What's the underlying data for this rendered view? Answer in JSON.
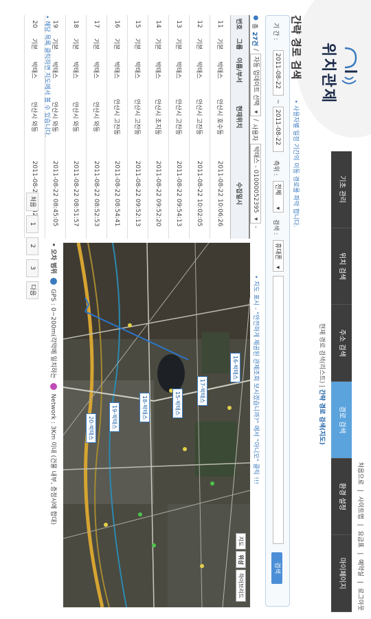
{
  "brand": {
    "title": "위치관제"
  },
  "toplinks": [
    "처음으로",
    "|",
    "사이트맵",
    "|",
    "요금표",
    "|",
    "예약실",
    "|",
    "로그아웃"
  ],
  "nav": {
    "items": [
      "기초 관리",
      "위치 검색",
      "주소 검색",
      "경로 검색",
      "환경 설정",
      "마이페이지"
    ],
    "active_index": 3
  },
  "subnav": {
    "prefix": "현재 경로 검색(리스트)",
    "sep": " | ",
    "current": "간략 경로 검색(지도)"
  },
  "page": {
    "title": "간략 경로 검색",
    "desc": "• 사용자별 일정 기간의 이동 경로를 파악 합니다."
  },
  "search": {
    "period_label": "기 간 :",
    "date_from": "2011-08-22",
    "tilde": "~",
    "date_to": "2011-08-22",
    "type_label": "측위 :",
    "type_value": "전체",
    "cond_label": "검색 :",
    "cond_value": "휴대폰",
    "button": "검색"
  },
  "list_header": {
    "bullet": "●",
    "total_prefix": "총",
    "total_count": "27건",
    "sep1": "/",
    "auto_refresh": "자동 업데이트 선택",
    "sep2": "/",
    "user_label": "사용자",
    "user_value": "박태스 - 01000052395",
    "dash": "-"
  },
  "map_note": "• 지도 표시 - \"안전하게 제공된 관제조회 보시겠습니까?\" 에서 \"아니오\" 클릭 !!!",
  "table": {
    "columns": [
      "번호",
      "그룹",
      "이름/부서",
      "현재위치",
      "수집일시"
    ],
    "rows": [
      [
        "11",
        "기본",
        "박태스",
        "안산시 호수동",
        "2011-08-22 10:06:26"
      ],
      [
        "12",
        "기본",
        "박태스",
        "안산시 고잔동",
        "2011-08-22 10:02:05"
      ],
      [
        "13",
        "기본",
        "박태스",
        "안산시 고잔동",
        "2011-08-22 09:54:13"
      ],
      [
        "14",
        "기본",
        "박태스",
        "안산시 초지동",
        "2011-08-22 09:52:20"
      ],
      [
        "15",
        "기본",
        "박태스",
        "안산시 고잔동",
        "2011-08-22 09:52:13"
      ],
      [
        "16",
        "기본",
        "박태스",
        "안산시 고잔동",
        "2011-08-22 08:54:41"
      ],
      [
        "17",
        "기본",
        "박태스",
        "안산시 와동",
        "2011-08-22 08:52:53"
      ],
      [
        "18",
        "기본",
        "박태스",
        "안산시 와동",
        "2011-08-22 08:51:57"
      ],
      [
        "19",
        "기본",
        "박태스",
        "안산시 와동",
        "2011-08-22 08:45:05"
      ],
      [
        "20",
        "기본",
        "박태스",
        "안산시 와동",
        "2011-08-22 08:42:12"
      ]
    ]
  },
  "table_note": "• 해당 목록 클릭하면 지도에서 볼 수 있습니다.",
  "pager": [
    "처음",
    "1",
    "2",
    "3",
    "다음"
  ],
  "map": {
    "buttons": [
      "지도",
      "위성",
      "하이브리드"
    ],
    "active_button": 2,
    "pins": [
      "16-박태스",
      "17-박태스",
      "15-박태스",
      "18-박태스",
      "19-박태스",
      "20-박태스"
    ]
  },
  "legend": {
    "title": "• 오차 범위",
    "gps": "GPS : 0~200m(각막에 일치하는",
    "network": "Network : 3Km 이내 (건물 내부, 층정시에 합대)"
  },
  "colors": {
    "accent": "#5ba3dd",
    "nav_bg": "#3d3d3d",
    "link": "#3a7abf"
  }
}
